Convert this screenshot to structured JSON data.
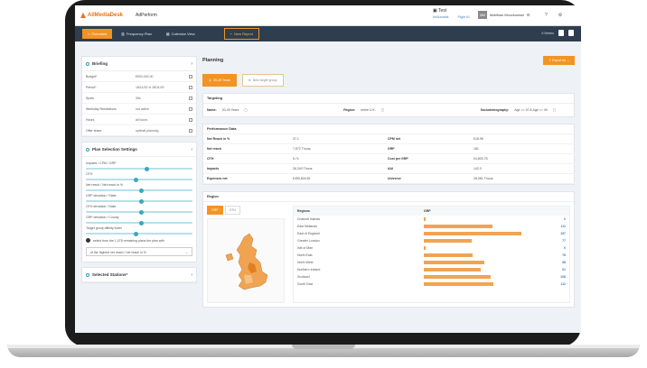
{
  "brand": {
    "name": "AllMediaDesk",
    "app": "AdPerform"
  },
  "project": {
    "title": "Test",
    "links": [
      "McDonalds",
      "Flight #1"
    ]
  },
  "user": {
    "initials": "MM",
    "name": "Matthias Moczkowski"
  },
  "nav": {
    "tabs": [
      "Overview",
      "Frequency Plan",
      "Calendar View"
    ],
    "new_report": "New Report",
    "right_label": "6 Weeks"
  },
  "briefing": {
    "title": "Briefing",
    "rows": [
      {
        "label": "Budget*",
        "value": "€500,000.00"
      },
      {
        "label": "Period*",
        "value": "18/11/20 ⊖ 28/11/20"
      },
      {
        "label": "Spots",
        "value": "30s"
      },
      {
        "label": "Weekday Restrictions",
        "value": "not active"
      },
      {
        "label": "Hours",
        "value": "all hours"
      },
      {
        "label": "Offer share",
        "value": "optimal planning"
      }
    ]
  },
  "plan_settings": {
    "title": "Plan Selection Settings",
    "sliders": [
      {
        "label": "Impacts / CPM / GRP",
        "level": 0.55
      },
      {
        "label": "OTH",
        "level": 0.45
      },
      {
        "label": "Net reach / Net reach in %",
        "level": 0.5
      },
      {
        "label": "GRP deviation / State",
        "level": 0.5
      },
      {
        "label": "OTH deviation / State",
        "level": 0.5
      },
      {
        "label": "GRP deviation / County",
        "level": 0.5
      },
      {
        "label": "Target group affinity index",
        "level": 0.45
      }
    ],
    "note": "select from the 1,078 remaining plans the plan with",
    "select_value": "of the highest net reach / net reach in %"
  },
  "selected_stations": {
    "title": "Selected Stations*"
  },
  "planning": {
    "title": "Planning",
    "export": "Export As",
    "tabs": [
      "20-49 Years",
      "New target group"
    ]
  },
  "targeting": {
    "title": "Targeting",
    "fields": [
      {
        "label": "Name:",
        "value": "20-49 Years"
      },
      {
        "label": "Region:",
        "value": "entire U.K."
      },
      {
        "label": "Sociodemography:",
        "value": "Age >= 20 & Age <= 49"
      }
    ]
  },
  "performance": {
    "title": "Performance Data",
    "rows": [
      [
        "Net Reach in %",
        "37.1",
        "CPM net",
        "£18.98"
      ],
      [
        "Net reach",
        "7,872 Thous.",
        "GRP",
        "181"
      ],
      [
        "OTH",
        "5.7x",
        "Cost per GRP",
        "£4,800.78"
      ],
      [
        "Impacts",
        "26,340 Thous.",
        "AAI",
        "142.3"
      ],
      [
        "Expenses net",
        "£499,818.82",
        "Universe",
        "28,081 Thous."
      ]
    ]
  },
  "regions": {
    "title": "Region",
    "map_tabs": [
      "GRP",
      "OTH"
    ],
    "col_region": "Regions",
    "col_grp": "GRP",
    "rows": [
      {
        "name": "Channel Islands",
        "grp": 0
      },
      {
        "name": "East Midlands",
        "grp": 111
      },
      {
        "name": "East of England",
        "grp": 157
      },
      {
        "name": "Greater London",
        "grp": 77
      },
      {
        "name": "Isle of Man",
        "grp": 0
      },
      {
        "name": "North East",
        "grp": 78
      },
      {
        "name": "North West",
        "grp": 98
      },
      {
        "name": "Northern Ireland",
        "grp": 91
      },
      {
        "name": "Scotland",
        "grp": 108
      },
      {
        "name": "South East",
        "grp": 112
      }
    ],
    "max": 160
  },
  "colors": {
    "accent": "#f29423",
    "nav": "#2f3e4e",
    "teal": "#3aa7bf"
  }
}
